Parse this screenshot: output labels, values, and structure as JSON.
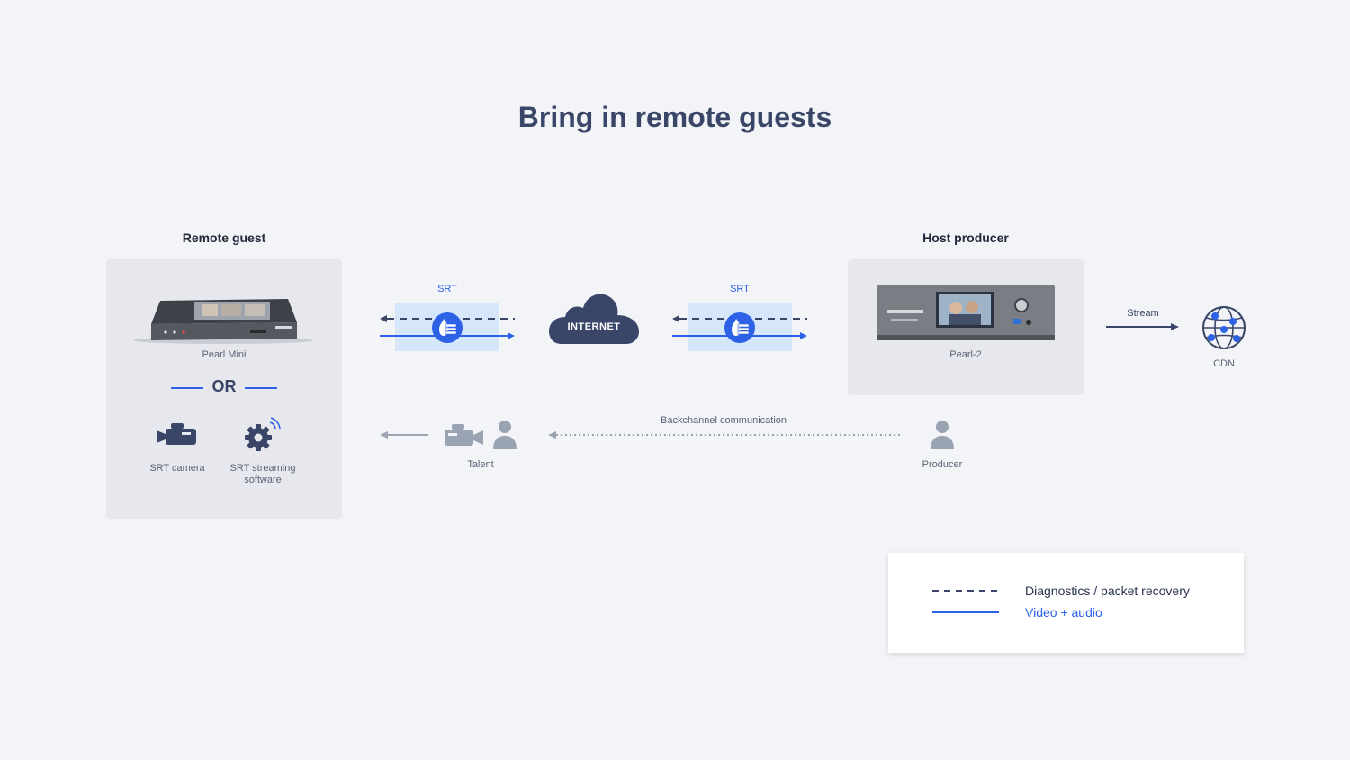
{
  "title": "Bring in remote guests",
  "remote_guest": {
    "heading": "Remote guest",
    "device_label": "Pearl Mini",
    "or_label": "OR",
    "srt_camera_label": "SRT camera",
    "srt_software_label_line1": "SRT streaming",
    "srt_software_label_line2": "software"
  },
  "links": {
    "left_srt_label": "SRT",
    "right_srt_label": "SRT",
    "internet_label": "INTERNET"
  },
  "host_producer": {
    "heading": "Host producer",
    "device_label": "Pearl-2",
    "stream_label": "Stream",
    "cdn_label": "CDN"
  },
  "backchannel": {
    "label": "Backchannel communication",
    "talent_label": "Talent",
    "producer_label": "Producer"
  },
  "legend": {
    "dashed_label": "Diagnostics / packet recovery",
    "solid_label": "Video + audio"
  },
  "colors": {
    "navy": "#3a4668",
    "blue": "#2d62e6",
    "light_blue_band": "#d6e6fb",
    "gray_icon": "#9aa3b1"
  }
}
